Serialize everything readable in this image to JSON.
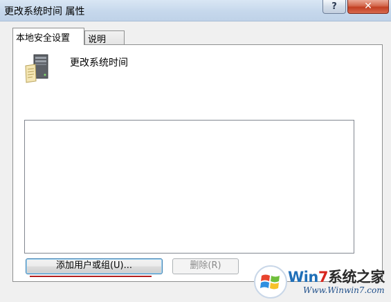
{
  "window": {
    "title": "更改系统时间 属性",
    "help_glyph": "?",
    "close_glyph": "✕"
  },
  "tabs": [
    {
      "label": "本地安全设置",
      "active": true
    },
    {
      "label": "说明",
      "active": false
    }
  ],
  "policy": {
    "icon": "server-icon",
    "name": "更改系统时间"
  },
  "members_list": {
    "items": []
  },
  "buttons": {
    "add_label": "添加用户或组(U)...",
    "remove_label": "删除(R)",
    "remove_enabled": false
  },
  "watermark": {
    "brand_prefix": "Win",
    "brand_seven": "7",
    "brand_suffix": "系统之家",
    "url": "Www.Winwin7.com"
  },
  "colors": {
    "accent_underline": "#b21e1e",
    "close_button": "#c23f22"
  }
}
